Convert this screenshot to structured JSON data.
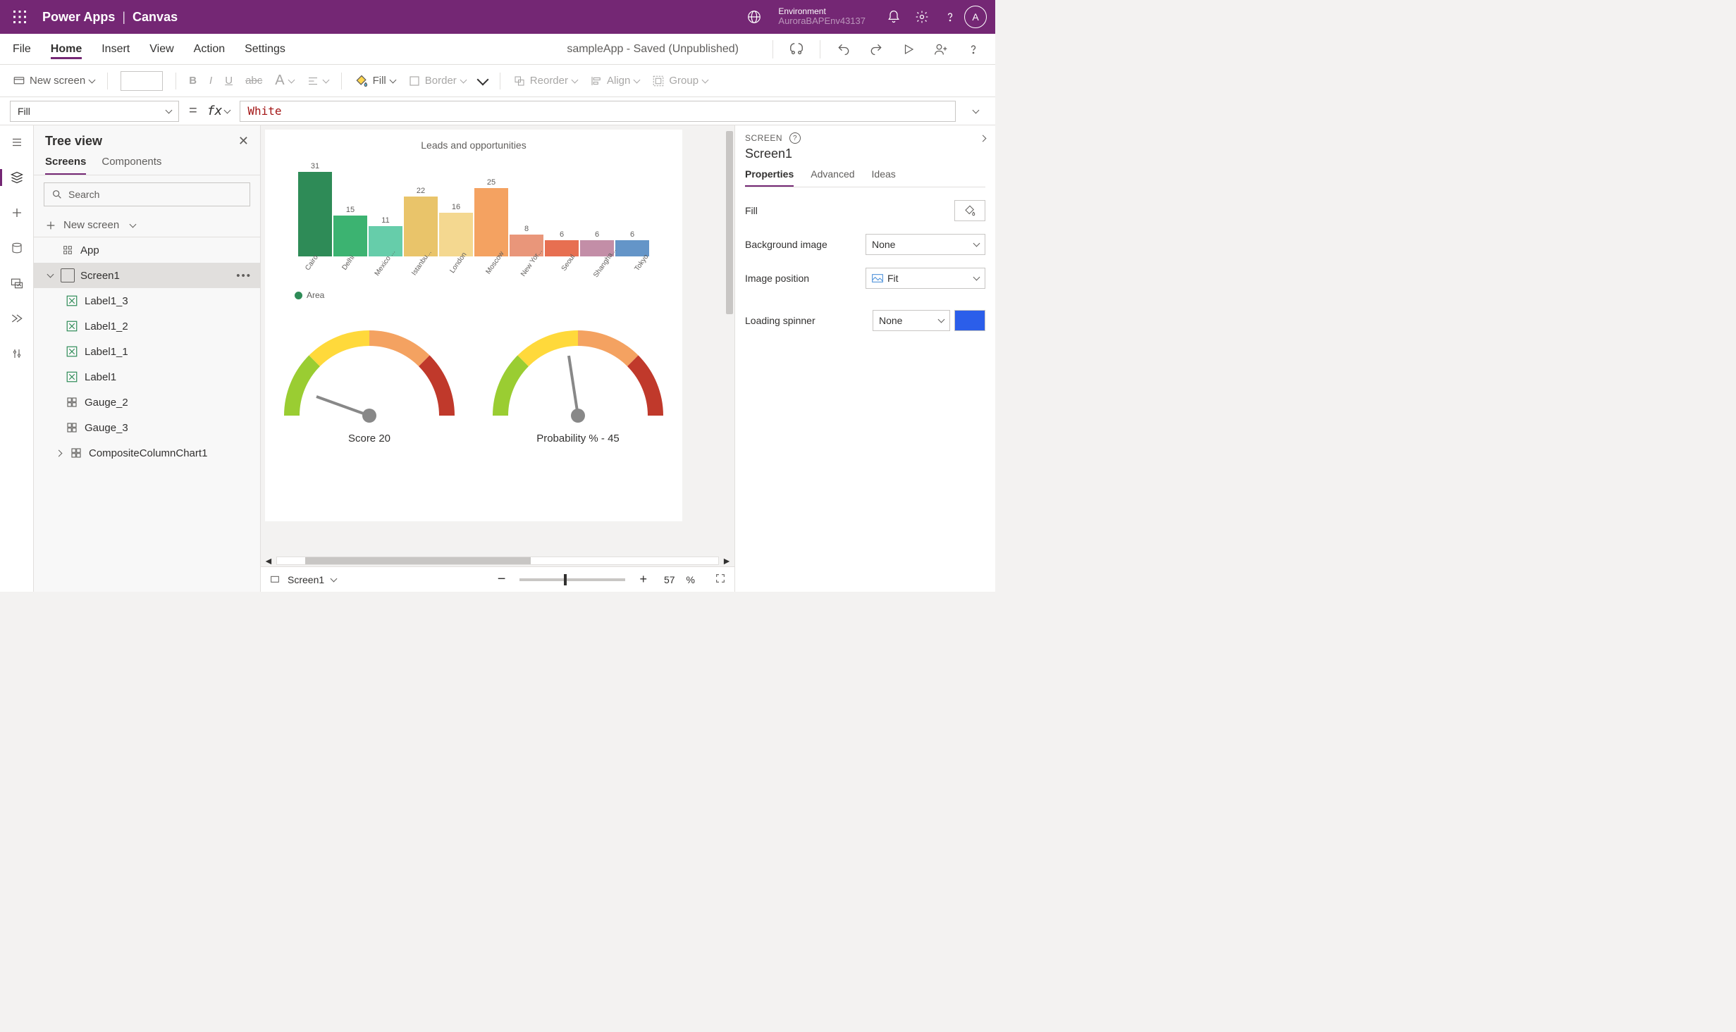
{
  "topbar": {
    "brand_app": "Power Apps",
    "brand_sep": "|",
    "brand_mode": "Canvas",
    "env_label": "Environment",
    "env_value": "AuroraBAPEnv43137",
    "avatar_initial": "A"
  },
  "menubar": {
    "items": [
      "File",
      "Home",
      "Insert",
      "View",
      "Action",
      "Settings"
    ],
    "active": "Home",
    "doc_status": "sampleApp - Saved (Unpublished)"
  },
  "toolbar": {
    "new_screen": "New screen",
    "fill": "Fill",
    "border": "Border",
    "reorder": "Reorder",
    "align": "Align",
    "group": "Group",
    "bold": "B",
    "italic": "I",
    "underline": "U",
    "strike": "abc",
    "fontcolor": "A"
  },
  "fx": {
    "property": "Fill",
    "fx_label": "fx",
    "value": "White",
    "eq": "="
  },
  "tree": {
    "title": "Tree view",
    "tabs": [
      "Screens",
      "Components"
    ],
    "active_tab": "Screens",
    "search_placeholder": "Search",
    "new_screen": "New screen",
    "items": [
      {
        "label": "App",
        "depth": 0,
        "icon": "app"
      },
      {
        "label": "Screen1",
        "depth": 1,
        "icon": "screen",
        "expanded": true,
        "selected": true
      },
      {
        "label": "Label1_3",
        "depth": 2,
        "icon": "label"
      },
      {
        "label": "Label1_2",
        "depth": 2,
        "icon": "label"
      },
      {
        "label": "Label1_1",
        "depth": 2,
        "icon": "label"
      },
      {
        "label": "Label1",
        "depth": 2,
        "icon": "label"
      },
      {
        "label": "Gauge_2",
        "depth": 2,
        "icon": "gauge"
      },
      {
        "label": "Gauge_3",
        "depth": 2,
        "icon": "gauge"
      },
      {
        "label": "CompositeColumnChart1",
        "depth": 2,
        "icon": "chart",
        "collapsed_child": true
      }
    ]
  },
  "chart_data": {
    "type": "bar",
    "title": "Leads and opportunities",
    "legend": "Area",
    "categories": [
      "Cairo",
      "Delhi",
      "Mexico ...",
      "Istanbu...",
      "London",
      "Moscow",
      "New Yor...",
      "Seoul",
      "Shangha...",
      "Tokyo"
    ],
    "values": [
      31,
      15,
      11,
      22,
      16,
      25,
      8,
      6,
      6,
      6
    ],
    "colors": [
      "#2e8b57",
      "#3cb371",
      "#66cdaa",
      "#e9c46a",
      "#f4d890",
      "#f4a261",
      "#e9967a",
      "#e76f51",
      "#c38ea7",
      "#6495c8"
    ],
    "ylim": [
      0,
      31
    ]
  },
  "gauges": [
    {
      "label": "Score",
      "value": 20,
      "display": "Score    20"
    },
    {
      "label": "Probability % -",
      "value": 45,
      "display": "Probability % -   45"
    }
  ],
  "canvas_status": {
    "screen": "Screen1",
    "zoom_pct": "57",
    "pct_sym": "%"
  },
  "props": {
    "header": "SCREEN",
    "name": "Screen1",
    "tabs": [
      "Properties",
      "Advanced",
      "Ideas"
    ],
    "active_tab": "Properties",
    "rows": {
      "fill_label": "Fill",
      "bg_label": "Background image",
      "bg_value": "None",
      "imgpos_label": "Image position",
      "imgpos_value": "Fit",
      "spinner_label": "Loading spinner",
      "spinner_value": "None",
      "spinner_color": "#2b5eea"
    }
  }
}
